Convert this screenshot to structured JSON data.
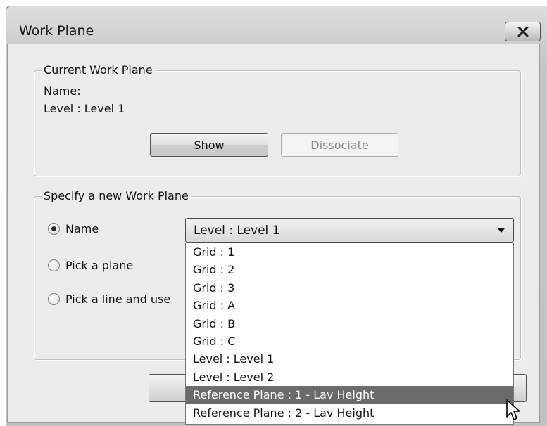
{
  "window": {
    "title": "Work Plane",
    "close_icon": "close-x-icon"
  },
  "current_work_plane": {
    "group_title": "Current Work Plane",
    "name_label": "Name:",
    "name_value": "Level : Level 1",
    "show_label": "Show",
    "dissociate_label": "Dissociate",
    "dissociate_enabled": false
  },
  "new_work_plane": {
    "group_title": "Specify a new Work Plane",
    "options": [
      {
        "label": "Name",
        "checked": true
      },
      {
        "label": "Pick a plane",
        "checked": false
      },
      {
        "label": "Pick a line and use",
        "checked": false
      }
    ],
    "combo_value": "Level : Level 1",
    "dropdown_items": [
      "Grid : 1",
      "Grid : 2",
      "Grid : 3",
      "Grid : A",
      "Grid : B",
      "Grid : C",
      "Level : Level 1",
      "Level : Level 2",
      "Reference Plane : 1 - Lav Height",
      "Reference Plane : 2 - Lav Height"
    ],
    "highlighted_item": "Reference Plane : 1 - Lav Height"
  },
  "colors": {
    "highlight_bg": "#6b6b6b",
    "dialog_bg": "#ececec",
    "disabled_text": "#8a8a8a"
  }
}
